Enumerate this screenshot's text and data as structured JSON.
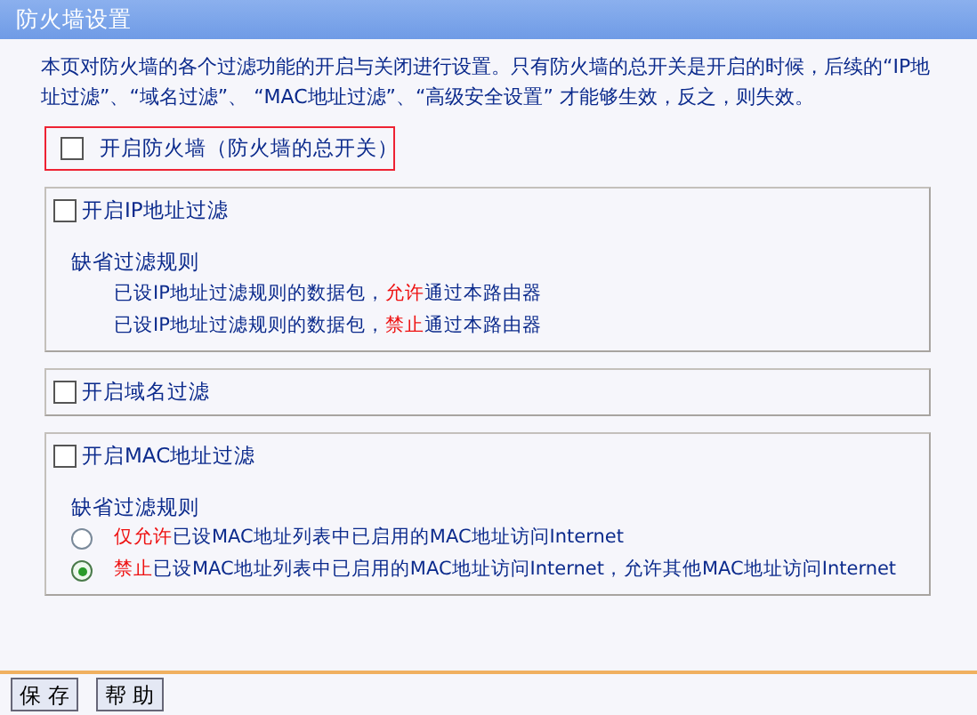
{
  "title": "防火墙设置",
  "intro": "本页对防火墙的各个过滤功能的开启与关闭进行设置。只有防火墙的总开关是开启的时候，后续的“IP地址过滤”、“域名过滤”、 “MAC地址过滤”、“高级安全设置” 才能够生效，反之，则失效。",
  "master": {
    "label": "开启防火墙（防火墙的总开关）",
    "checked": false
  },
  "sections": [
    {
      "label": "开启IP地址过滤",
      "checked": false,
      "rules_title": "缺省过滤规则",
      "rules": [
        {
          "parts": [
            {
              "kind": "plain",
              "text": "已设IP地址过滤规则的数据包，"
            },
            {
              "kind": "highlight",
              "text": "允许"
            },
            {
              "kind": "plain",
              "text": "通过本路由器"
            }
          ]
        },
        {
          "parts": [
            {
              "kind": "plain",
              "text": "已设IP地址过滤规则的数据包，"
            },
            {
              "kind": "highlight",
              "text": "禁止"
            },
            {
              "kind": "plain",
              "text": "通过本路由器"
            }
          ]
        }
      ]
    },
    {
      "label": "开启域名过滤",
      "checked": false
    },
    {
      "label": "开启MAC地址过滤",
      "checked": false,
      "rules_title": "缺省过滤规则",
      "rules": [
        {
          "selected": false,
          "parts": [
            {
              "kind": "highlight",
              "text": "仅允许"
            },
            {
              "kind": "plain",
              "text": "已设MAC地址列表中已启用的MAC地址访问Internet"
            }
          ]
        },
        {
          "selected": true,
          "parts": [
            {
              "kind": "highlight",
              "text": "禁止"
            },
            {
              "kind": "plain",
              "text": "已设MAC地址列表中已启用的MAC地址访问Internet，允许其他MAC地址访问Internet"
            }
          ]
        }
      ]
    }
  ],
  "buttons": [
    "保 存",
    "帮 助"
  ]
}
